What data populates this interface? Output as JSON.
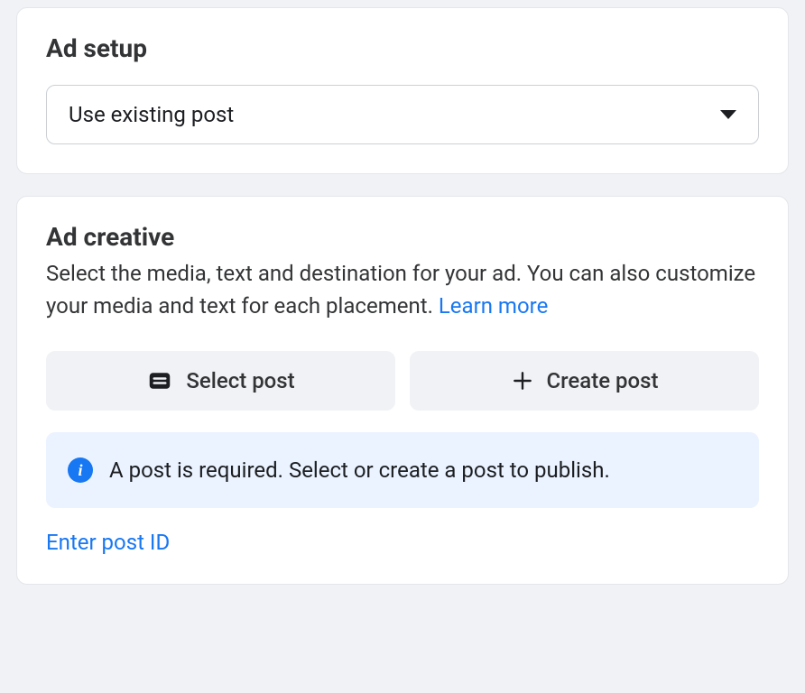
{
  "ad_setup": {
    "title": "Ad setup",
    "dropdown_value": "Use existing post"
  },
  "ad_creative": {
    "title": "Ad creative",
    "description_prefix": "Select the media, text and destination for your ad. You can also customize your media and text for each placement. ",
    "learn_more": "Learn more",
    "select_post_label": "Select post",
    "create_post_label": "Create post",
    "info_message": "A post is required. Select or create a post to publish.",
    "enter_post_id": "Enter post ID"
  }
}
